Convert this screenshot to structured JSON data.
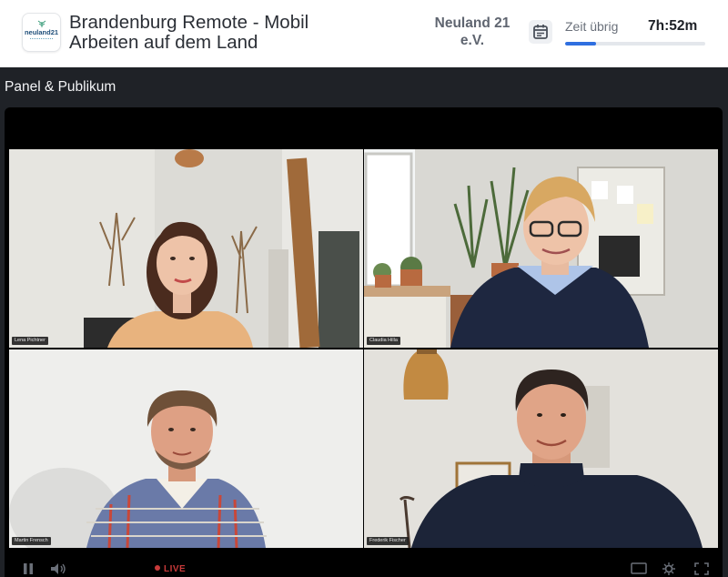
{
  "header": {
    "logo_text": "neuland21",
    "event_title": "Brandenburg Remote - Mobil Arbeiten auf dem Land",
    "org_name": "Neuland 21 e.V.",
    "calendar_icon": "calendar-icon",
    "time_label": "Zeit übrig",
    "time_value": "7h:52m",
    "time_progress_fraction": 0.22,
    "accent_color": "#2f6fe0"
  },
  "section": {
    "title": "Panel & Publikum"
  },
  "video": {
    "participants": [
      {
        "name": "Lena Pichtner"
      },
      {
        "name": "Claudia Hilla"
      },
      {
        "name": "Martin Frensch"
      },
      {
        "name": "Frederik Fischer"
      }
    ],
    "controls": {
      "play_pause_icon": "pause-icon",
      "volume_icon": "volume-icon",
      "live_label": "LIVE",
      "quality_icon": "screen-icon",
      "settings_icon": "gear-icon",
      "fullscreen_icon": "fullscreen-icon"
    }
  }
}
